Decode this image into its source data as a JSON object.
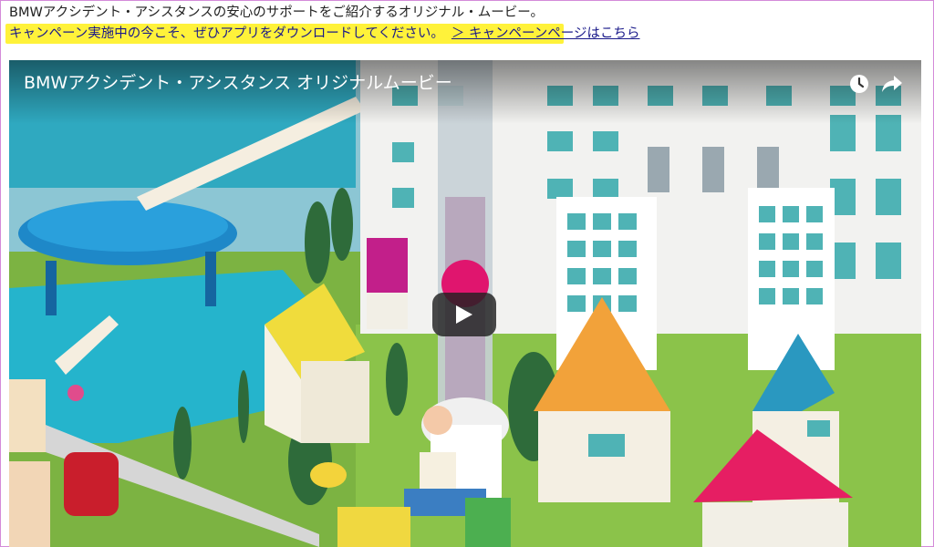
{
  "intro_text": "BMWアクシデント・アシスタンスの安心のサポートをご紹介するオリジナル・ムービー。",
  "campaign": {
    "text": "キャンペーン実施中の今こそ、ぜひアプリをダウンロードしてください。",
    "link": "＞ キャンペーンページはこちら",
    "highlight_color": "#fff23a"
  },
  "video": {
    "title": "BMWアクシデント・アシスタンス オリジナルムービー",
    "watch_later_icon": "clock-icon",
    "share_icon": "share-arrow-icon",
    "play_icon": "play-icon"
  },
  "colors": {
    "grass": "#7cb342",
    "pond": "#2bb0c9",
    "building": "#f2f2f0",
    "window": "#4fb3b5"
  }
}
